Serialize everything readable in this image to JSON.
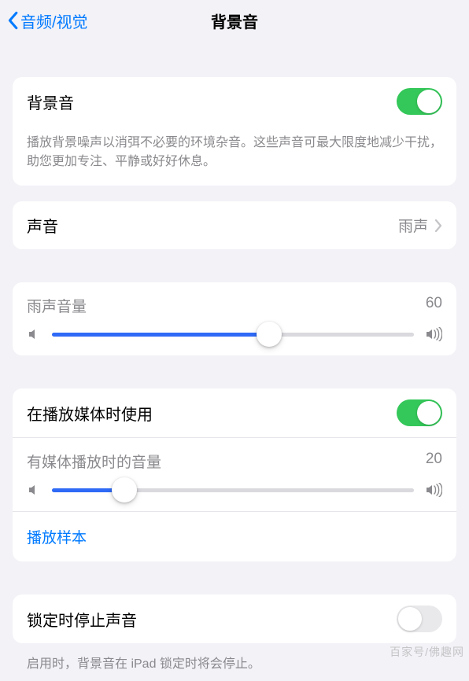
{
  "nav": {
    "back_label": "音频/视觉",
    "title": "背景音"
  },
  "main_toggle": {
    "label": "背景音",
    "on": true,
    "footer": "播放背景噪声以消弭不必要的环境杂音。这些声音可最大限度地减少干扰，助您更加专注、平静或好好休息。"
  },
  "sound_row": {
    "label": "声音",
    "value": "雨声"
  },
  "rain_volume": {
    "label": "雨声音量",
    "value": 60
  },
  "media_block": {
    "use_label": "在播放媒体时使用",
    "use_on": true,
    "media_vol_label": "有媒体播放时的音量",
    "media_vol_value": 20,
    "play_sample": "播放样本"
  },
  "lock_block": {
    "label": "锁定时停止声音",
    "on": false,
    "footer": "启用时，背景音在 iPad 锁定时将会停止。"
  },
  "watermark": "百家号/佛趣网"
}
